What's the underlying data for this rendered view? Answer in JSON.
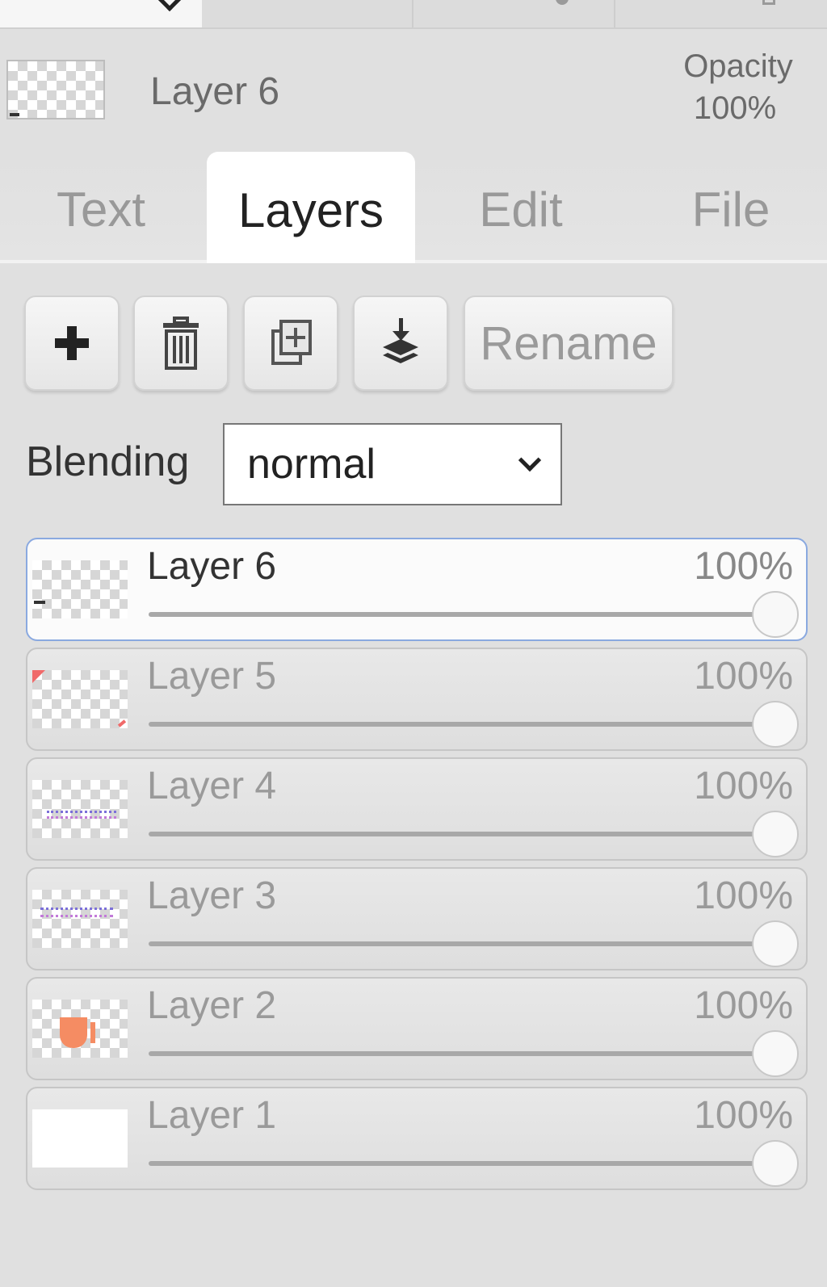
{
  "header": {
    "current_layer_name": "Layer 6",
    "opacity_label": "Opacity",
    "opacity_value": "100%"
  },
  "tabs": [
    {
      "label": "Text",
      "active": false
    },
    {
      "label": "Layers",
      "active": true
    },
    {
      "label": "Edit",
      "active": false
    },
    {
      "label": "File",
      "active": false
    }
  ],
  "toolbar": {
    "add_icon": "plus-icon",
    "delete_icon": "trash-icon",
    "duplicate_icon": "duplicate-icon",
    "merge_icon": "merge-down-icon",
    "rename_label": "Rename"
  },
  "blending": {
    "label": "Blending",
    "value": "normal"
  },
  "layers": [
    {
      "name": "Layer 6",
      "opacity": "100%",
      "opacity_fraction": 1.0,
      "active": true
    },
    {
      "name": "Layer 5",
      "opacity": "100%",
      "opacity_fraction": 1.0,
      "active": false
    },
    {
      "name": "Layer 4",
      "opacity": "100%",
      "opacity_fraction": 1.0,
      "active": false
    },
    {
      "name": "Layer 3",
      "opacity": "100%",
      "opacity_fraction": 1.0,
      "active": false
    },
    {
      "name": "Layer 2",
      "opacity": "100%",
      "opacity_fraction": 1.0,
      "active": false
    },
    {
      "name": "Layer 1",
      "opacity": "100%",
      "opacity_fraction": 1.0,
      "active": false
    }
  ],
  "colors": {
    "active_border": "#8aa9e0",
    "panel_bg": "#e0e0e0"
  }
}
